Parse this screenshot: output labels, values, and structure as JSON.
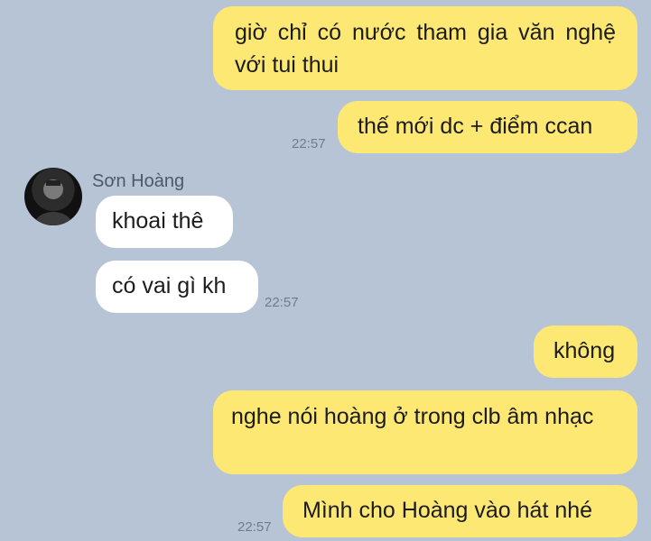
{
  "contact": {
    "name": "Sơn Hoàng"
  },
  "messages": [
    {
      "text": "giờ chỉ có nước tham gia văn nghệ với tui thui"
    },
    {
      "text": "thế mới dc + điểm ccan",
      "time": "22:57"
    },
    {
      "text": "khoai thê"
    },
    {
      "text": "có vai gì kh",
      "time": "22:57"
    },
    {
      "text": "không"
    },
    {
      "text": "nghe nói hoàng ở trong clb âm nhạc"
    },
    {
      "text": "Mình cho Hoàng vào hát nhé",
      "time": "22:57"
    }
  ],
  "colors": {
    "background": "#b6c4d6",
    "outgoing_bubble": "#fde874",
    "incoming_bubble": "#ffffff"
  },
  "icons": {
    "avatar": "user-photo-icon"
  }
}
